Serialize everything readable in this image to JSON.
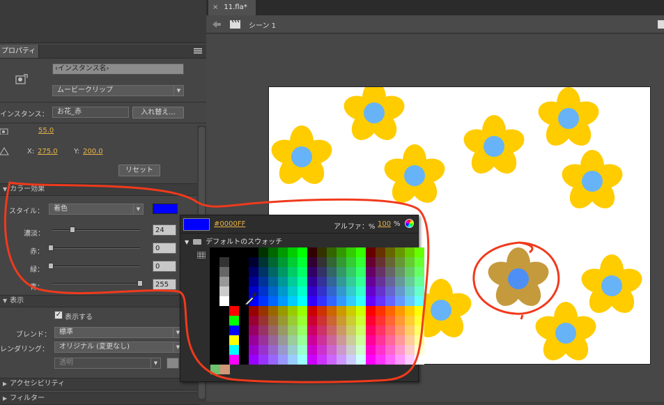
{
  "document_tab": {
    "title": "11.fla*",
    "close": "×"
  },
  "scene_bar": {
    "scene_label": "シーン 1"
  },
  "properties_panel": {
    "tab_label": "プロパティ",
    "instance_name_placeholder": "‹インスタンス名›",
    "symbol_type": "ムービークリップ",
    "instance_label": "インスタンス：",
    "instance_value": "お花_赤",
    "swap_button": "入れ替え...",
    "size_value": "55.0",
    "x_label": "X:",
    "x_value": "275.0",
    "y_label": "Y:",
    "y_value": "200.0",
    "reset_button": "リセット",
    "color_effect": {
      "section_title": "カラー効果",
      "style_label": "スタイル：",
      "style_value": "着色",
      "tint_color": "#0000FF",
      "sliders": [
        {
          "label": "濃淡：",
          "value": "24",
          "fraction": 0.24
        },
        {
          "label": "赤：",
          "value": "0",
          "fraction": 0
        },
        {
          "label": "緑：",
          "value": "0",
          "fraction": 0
        },
        {
          "label": "青：",
          "value": "255",
          "fraction": 1
        }
      ]
    },
    "display": {
      "section_title": "表示",
      "visible_label": "表示する",
      "visible_checked": true,
      "blend_label": "ブレンド：",
      "blend_value": "標準",
      "render_label": "レンダリング：",
      "render_value": "オリジナル (変更なし)",
      "transparent_value": "透明"
    },
    "accessibility_title": "アクセシビリティ",
    "filter_title": "フィルター"
  },
  "color_picker": {
    "hex": "#0000FF",
    "alpha_label": "アルファ：%",
    "alpha_value": "100",
    "alpha_unit": "%",
    "swatch_header": "デフォルトのスウォッチ"
  },
  "colors": {
    "flower_petal": "#FFCC00",
    "flower_center": "#66B3F7",
    "tinted_petal": "#C59A3C",
    "tinted_center": "#4D8FF5",
    "annotation": "#F03A1C"
  }
}
